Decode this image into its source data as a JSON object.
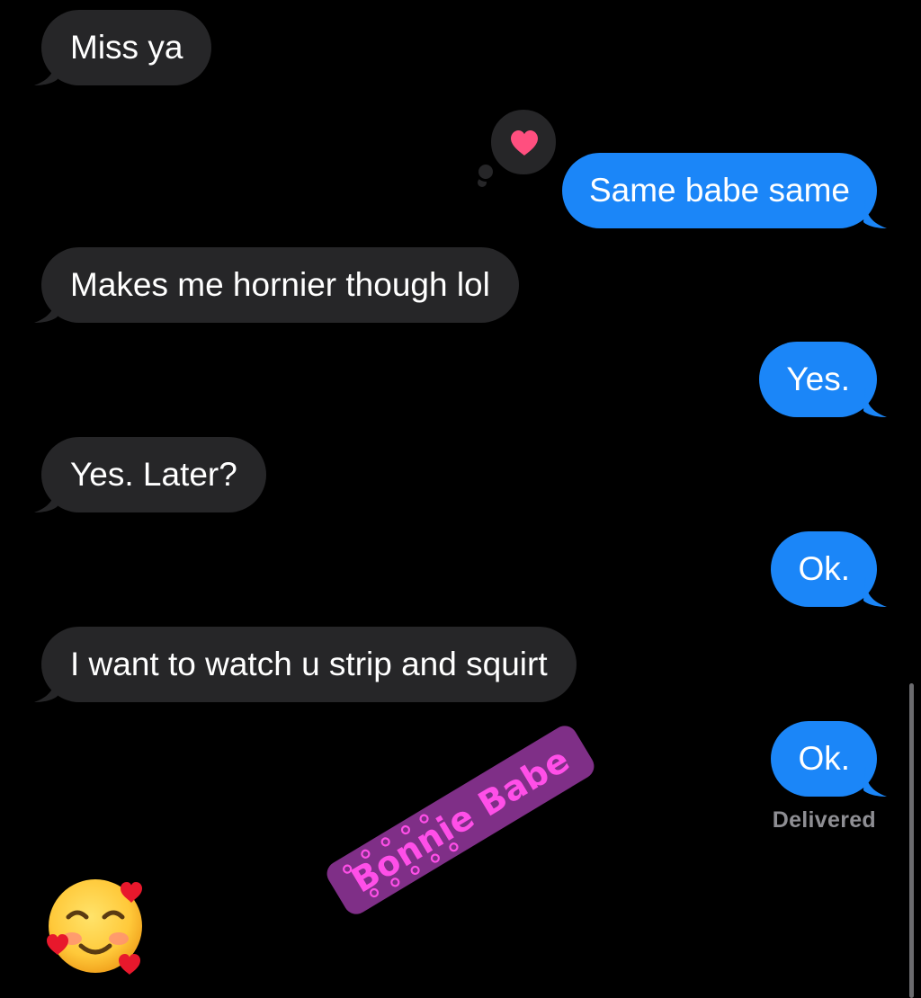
{
  "conversation": {
    "messages": [
      {
        "direction": "incoming",
        "text": "Miss ya"
      },
      {
        "direction": "outgoing",
        "text": "Same babe same",
        "tapback": "heart-icon"
      },
      {
        "direction": "incoming",
        "text": "Makes me hornier though lol"
      },
      {
        "direction": "outgoing",
        "text": "Yes."
      },
      {
        "direction": "incoming",
        "text": "Yes. Later?"
      },
      {
        "direction": "outgoing",
        "text": "Ok."
      },
      {
        "direction": "incoming",
        "text": "I want to watch u strip and squirt"
      },
      {
        "direction": "outgoing",
        "text": "Ok."
      }
    ],
    "status": "Delivered"
  },
  "overlays": {
    "sticker_text": "Bonnie Babe",
    "emoji": "smiling-face-with-hearts-icon"
  },
  "colors": {
    "background": "#000000",
    "incoming_bubble": "#262628",
    "outgoing_bubble": "#1b86f8",
    "status_text": "#8e8e93",
    "tapback_heart": "#ff4f7f",
    "sticker_bg": "#7f2f87",
    "sticker_text": "#ff4fe8"
  }
}
